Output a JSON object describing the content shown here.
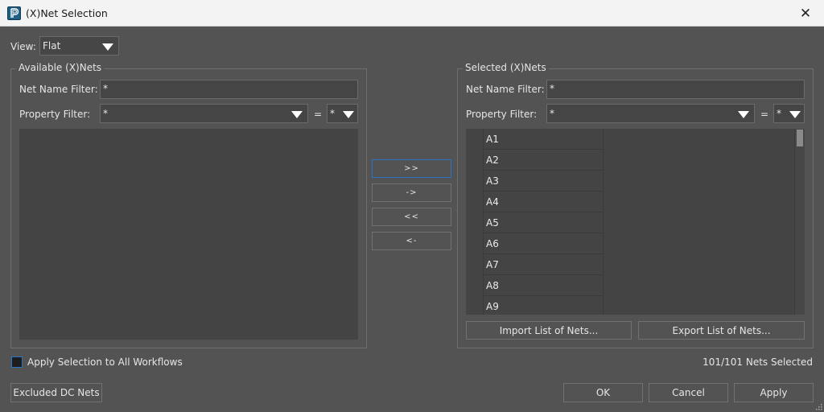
{
  "window": {
    "title": "(X)Net Selection",
    "icon": "app-logo-icon",
    "close_icon": "close-icon",
    "close_glyph": "✕"
  },
  "view": {
    "label": "View:",
    "selected": "Flat"
  },
  "available": {
    "group_title": "Available (X)Nets",
    "net_name_filter_label": "Net Name Filter:",
    "net_name_filter_value": "*",
    "property_filter_label": "Property Filter:",
    "property_filter_value": "*",
    "equals": "=",
    "property_value": "*",
    "items": []
  },
  "transfer_buttons": {
    "add_all": ">>",
    "add": "->",
    "remove_all": "<<",
    "remove": "<-"
  },
  "selected": {
    "group_title": "Selected (X)Nets",
    "net_name_filter_label": "Net Name Filter:",
    "net_name_filter_value": "*",
    "property_filter_label": "Property Filter:",
    "property_filter_value": "*",
    "equals": "=",
    "property_value": "*",
    "items": [
      "A1",
      "A2",
      "A3",
      "A4",
      "A5",
      "A6",
      "A7",
      "A8",
      "A9"
    ],
    "import_button": "Import List of Nets...",
    "export_button": "Export List of Nets..."
  },
  "footer": {
    "apply_all_label": "Apply Selection to All Workflows",
    "apply_all_checked": false,
    "status": "101/101 Nets Selected",
    "excluded_dc_nets": "Excluded DC Nets",
    "ok": "OK",
    "cancel": "Cancel",
    "apply": "Apply"
  }
}
